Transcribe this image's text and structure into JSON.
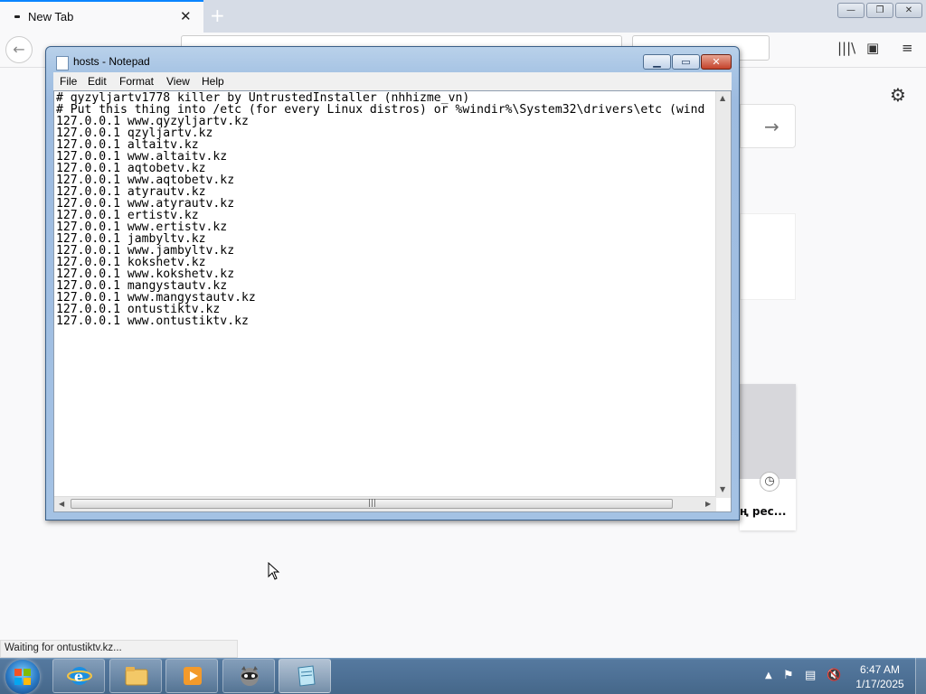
{
  "firefox": {
    "tab_title": "New Tab",
    "status_text": "Waiting for ontustiktv.kz...",
    "card_text": "ң рес..."
  },
  "notepad": {
    "title": "hosts - Notepad",
    "menu": [
      "File",
      "Edit",
      "Format",
      "View",
      "Help"
    ],
    "lines": [
      "# qyzyljartv1778 killer by UntrustedInstaller (nhhizme_vn)",
      "# Put this thing into /etc (for every Linux distros) or %windir%\\System32\\drivers\\etc (wind",
      "127.0.0.1 www.qyzyljartv.kz",
      "127.0.0.1 qzyljartv.kz",
      "127.0.0.1 altaitv.kz",
      "127.0.0.1 www.altaitv.kz",
      "127.0.0.1 aqtobetv.kz",
      "127.0.0.1 www.aqtobetv.kz",
      "127.0.0.1 atyrautv.kz",
      "127.0.0.1 www.atyrautv.kz",
      "127.0.0.1 ertistv.kz",
      "127.0.0.1 www.ertistv.kz",
      "127.0.0.1 jambyltv.kz",
      "127.0.0.1 www.jambyltv.kz",
      "127.0.0.1 kokshetv.kz",
      "127.0.0.1 www.kokshetv.kz",
      "127.0.0.1 mangystautv.kz",
      "127.0.0.1 www.mangystautv.kz",
      "127.0.0.1 ontustiktv.kz",
      "127.0.0.1 www.ontustiktv.kz"
    ]
  },
  "taskbar": {
    "time": "6:47 AM",
    "date": "1/17/2025"
  }
}
